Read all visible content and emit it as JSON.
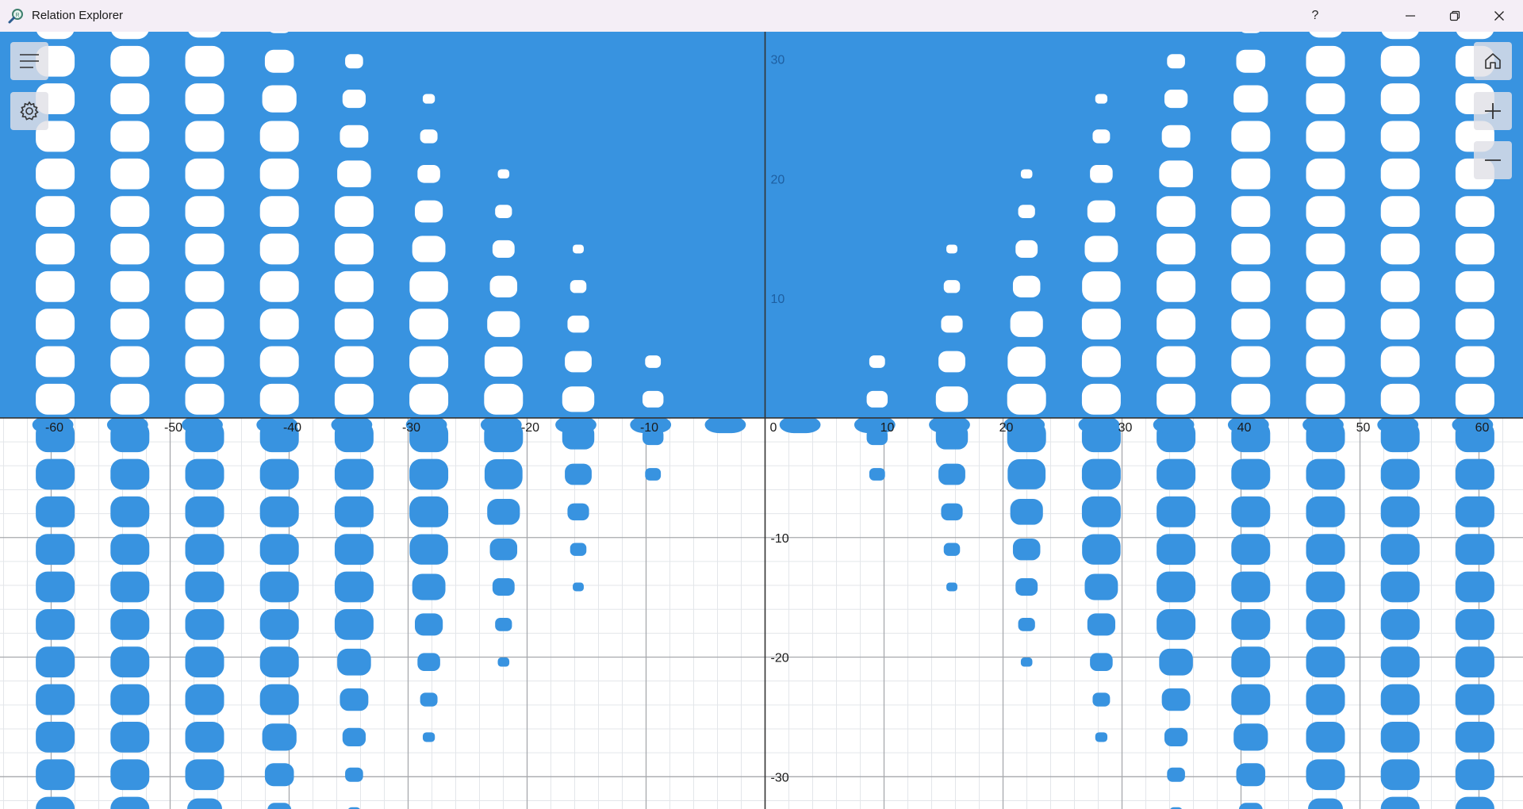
{
  "window": {
    "title": "Relation Explorer",
    "help_label": "?",
    "icon": "magnifier-app-icon"
  },
  "toolbar_left": {
    "menu_icon": "hamburger-menu-icon",
    "settings_icon": "gear-icon"
  },
  "toolbar_right": {
    "home_icon": "home-icon",
    "zoom_in_icon": "plus-icon",
    "zoom_out_icon": "minus-icon"
  },
  "colors": {
    "fill": "#3893e0",
    "minor_grid": "#e3e6ea",
    "major_grid": "#a7a9ad",
    "axis": "#333333",
    "label": "#1a1a1a",
    "label_on_fill": "#1e5fa1"
  },
  "chart_data": {
    "type": "region",
    "xlim": [
      -64.3,
      63.7
    ],
    "ylim": [
      -32.7,
      32.3
    ],
    "grid": true,
    "major_grid_step": 10,
    "minor_grid_step": 2,
    "x_ticks": [
      -60,
      -50,
      -40,
      -30,
      -20,
      -10,
      0,
      10,
      20,
      30,
      40,
      50,
      60
    ],
    "x_tick_labels": [
      "-60",
      "-50",
      "-40",
      "-30",
      "-20",
      "-10",
      "0",
      "10",
      "20",
      "30",
      "40",
      "50",
      "60"
    ],
    "y_ticks": [
      30,
      20,
      10,
      -10,
      -20,
      -30
    ],
    "y_tick_labels": [
      "30",
      "20",
      "10",
      "-10",
      "-20",
      "-30"
    ],
    "hole_lattice": {
      "dx": 6.28,
      "dy": 3.14,
      "x_offset": 3.14,
      "y_offset": 1.57
    }
  }
}
